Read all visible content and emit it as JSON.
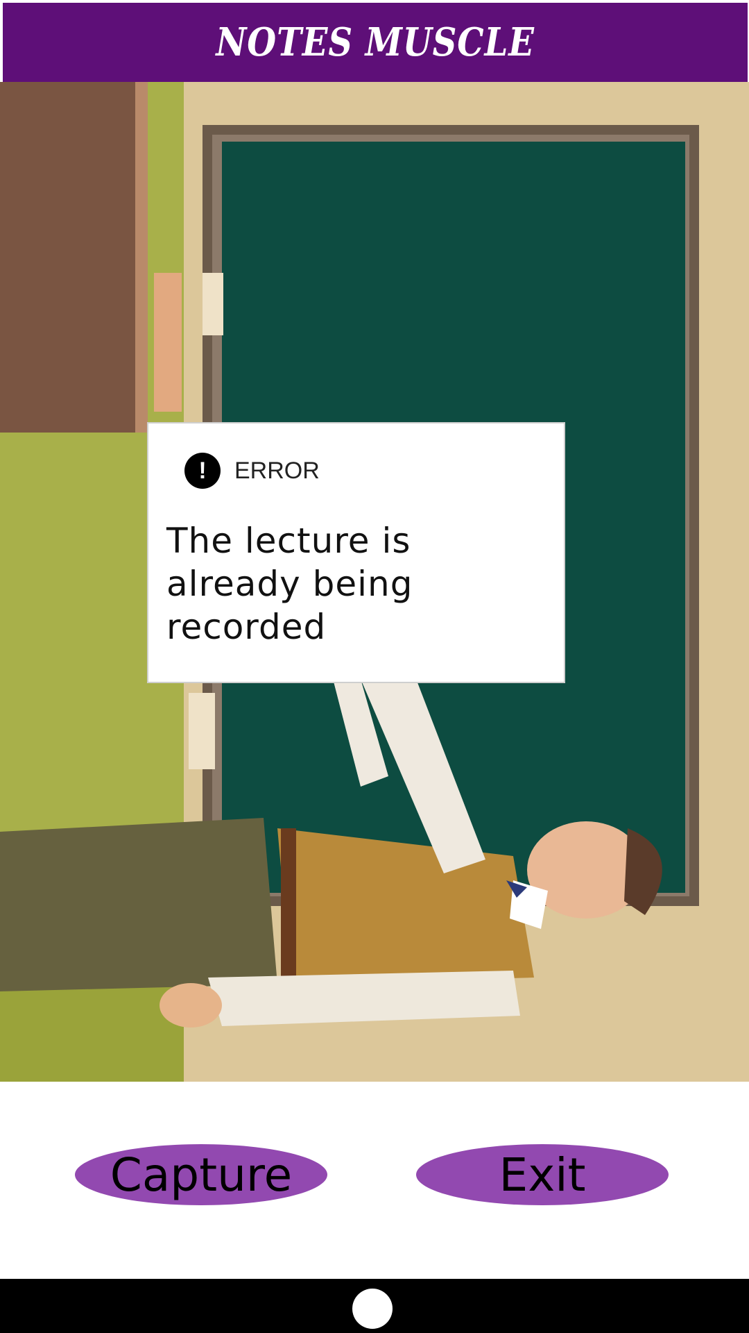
{
  "app": {
    "title": "NOTES MUSCLE"
  },
  "dialog": {
    "icon": "exclamation-icon",
    "label": "ERROR",
    "message": "The lecture is already being recorded"
  },
  "buttons": {
    "capture": "Capture",
    "exit": "Exit"
  },
  "colors": {
    "titlebar": "#5e0f78",
    "button": "#9249b0",
    "navbar": "#000000"
  },
  "navbar": {
    "home_icon": "home-circle-icon"
  }
}
